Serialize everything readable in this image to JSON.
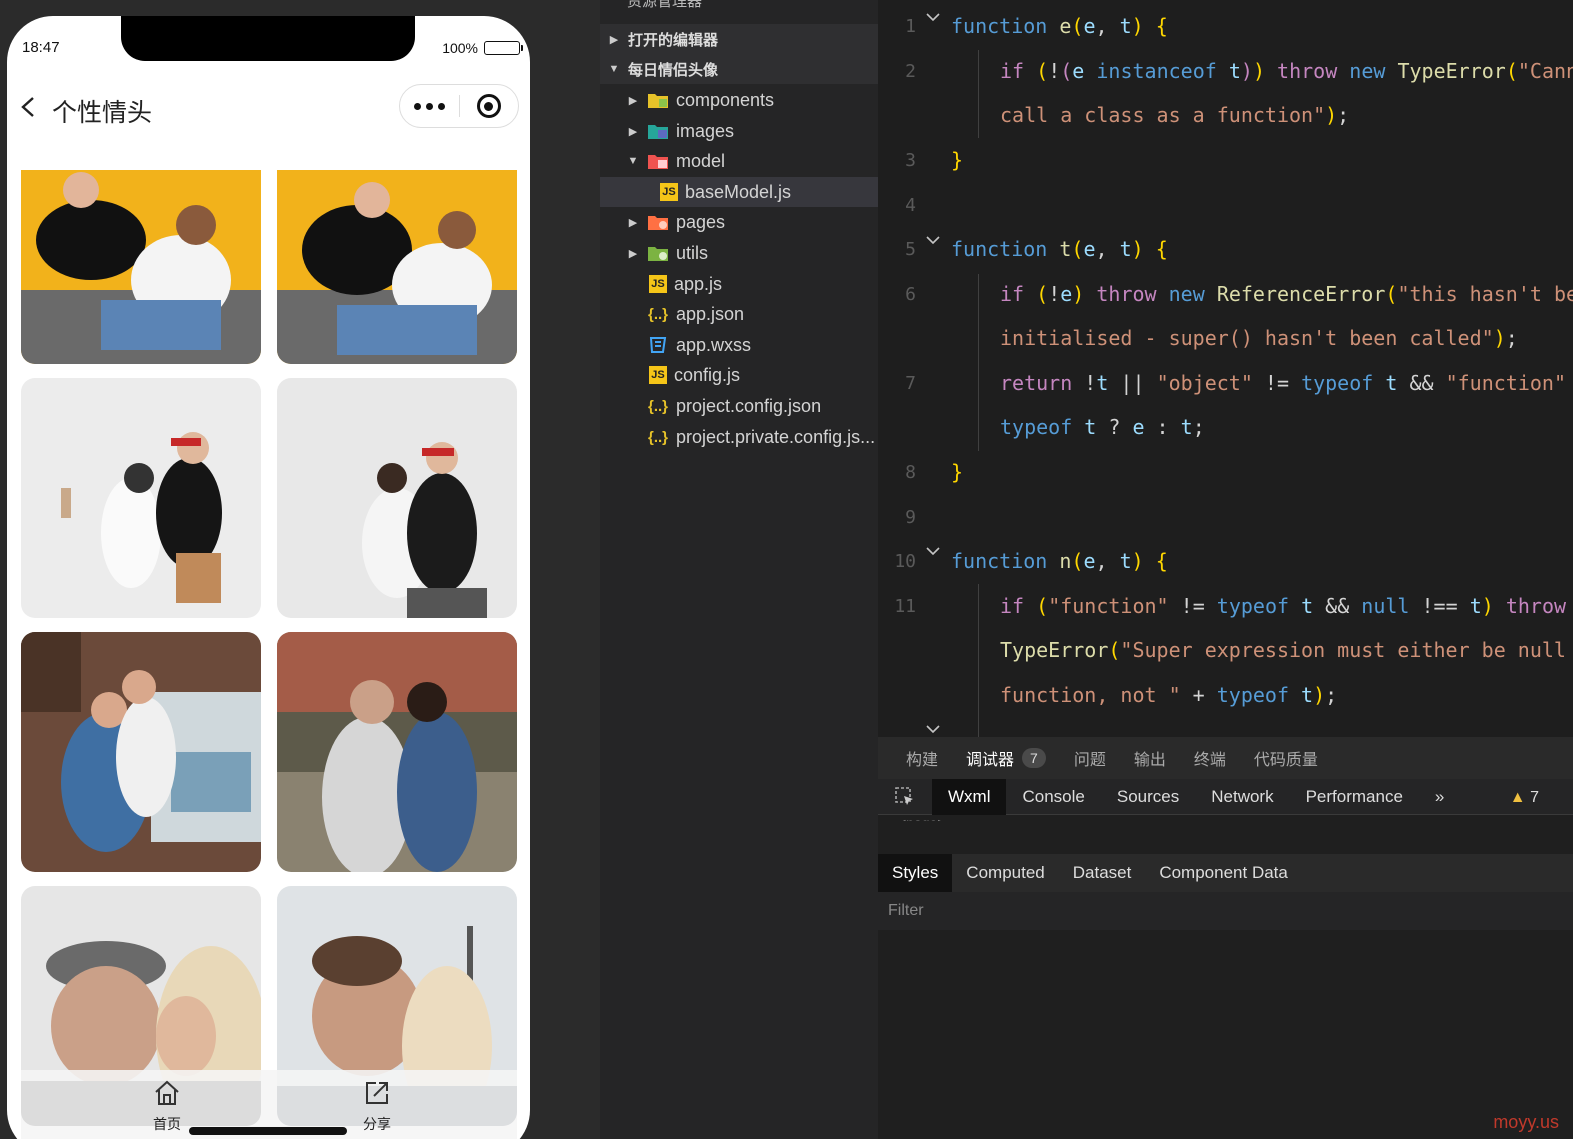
{
  "simulator": {
    "status": {
      "time": "18:47",
      "battery": "100%",
      "battery_level": 1.0
    },
    "nav": {
      "title": "个性情头"
    },
    "tabbar": {
      "home_label": "首页",
      "share_label": "分享"
    }
  },
  "explorer": {
    "header": "资源管理器",
    "sections": [
      {
        "label": "打开的编辑器"
      },
      {
        "label": "每日情侣头像"
      }
    ],
    "items": [
      {
        "label": "components",
        "icon": "folder-components-icon"
      },
      {
        "label": "images",
        "icon": "folder-images-icon"
      },
      {
        "label": "model",
        "icon": "folder-model-icon"
      },
      {
        "label": "baseModel.js",
        "icon": "js-file-icon"
      },
      {
        "label": "pages",
        "icon": "folder-pages-icon"
      },
      {
        "label": "utils",
        "icon": "folder-utils-icon"
      },
      {
        "label": "app.js",
        "icon": "js-file-icon"
      },
      {
        "label": "app.json",
        "icon": "json-file-icon"
      },
      {
        "label": "app.wxss",
        "icon": "css-file-icon"
      },
      {
        "label": "config.js",
        "icon": "js-file-icon"
      },
      {
        "label": "project.config.json",
        "icon": "json-file-icon"
      },
      {
        "label": "project.private.config.js...",
        "icon": "json-file-icon"
      }
    ]
  },
  "editor": {
    "line_numbers": [
      "1",
      "2",
      "3",
      "4",
      "5",
      "6",
      "7",
      "8",
      "9",
      "10",
      "11"
    ]
  },
  "devtools": {
    "tabs": [
      "构建",
      "调试器",
      "问题",
      "输出",
      "终端",
      "代码质量"
    ],
    "debugger_badge": "7",
    "panels": [
      "Wxml",
      "Console",
      "Sources",
      "Network",
      "Performance"
    ],
    "more": "»",
    "warning_count": "7",
    "wxml_snippet": "<page>",
    "style_tabs": [
      "Styles",
      "Computed",
      "Dataset",
      "Component Data"
    ],
    "filter_placeholder": "Filter"
  },
  "watermark": "moyy.us",
  "colors": {
    "keyword": "#569cd6",
    "function": "#dcdcaa",
    "string": "#ce9178",
    "accent_warning": "#f0c040"
  }
}
